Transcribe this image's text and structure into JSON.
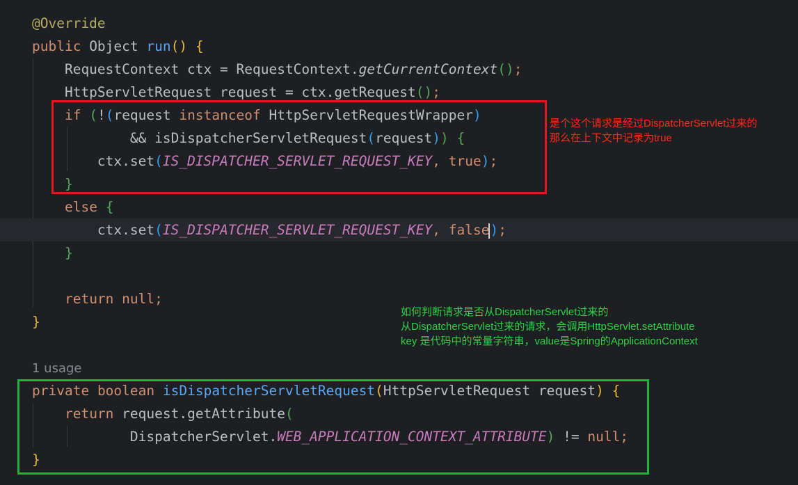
{
  "code": [
    {
      "segments": [
        {
          "t": "@Override",
          "c": "c-ann"
        }
      ]
    },
    {
      "segments": [
        {
          "t": "public",
          "c": "c-kw"
        },
        {
          "t": " Object ",
          "c": "c-txt"
        },
        {
          "t": "run",
          "c": "c-fn"
        },
        {
          "t": "()",
          "c": "c-p1"
        },
        {
          "t": " ",
          "c": "c-txt"
        },
        {
          "t": "{",
          "c": "c-p1"
        }
      ]
    },
    {
      "segments": [
        {
          "t": "    RequestContext ctx = RequestContext.",
          "c": "c-txt"
        },
        {
          "t": "getCurrentContext",
          "c": "c-ital"
        },
        {
          "t": "()",
          "c": "c-p2"
        },
        {
          "t": ";",
          "c": "c-kw"
        }
      ]
    },
    {
      "segments": [
        {
          "t": "    HttpServletRequest request = ctx.getRequest",
          "c": "c-txt"
        },
        {
          "t": "()",
          "c": "c-p2"
        },
        {
          "t": ";",
          "c": "c-kw"
        }
      ]
    },
    {
      "segments": [
        {
          "t": "    ",
          "c": "c-txt"
        },
        {
          "t": "if",
          "c": "c-kw"
        },
        {
          "t": " ",
          "c": "c-txt"
        },
        {
          "t": "(",
          "c": "c-p2"
        },
        {
          "t": "!",
          "c": "c-txt"
        },
        {
          "t": "(",
          "c": "c-p3"
        },
        {
          "t": "request ",
          "c": "c-txt"
        },
        {
          "t": "instanceof",
          "c": "c-kw"
        },
        {
          "t": " HttpServletRequestWrapper",
          "c": "c-txt"
        },
        {
          "t": ")",
          "c": "c-p3"
        }
      ]
    },
    {
      "segments": [
        {
          "t": "            && ",
          "c": "c-txt"
        },
        {
          "t": "isDispatcherServletRequest",
          "c": "c-txt"
        },
        {
          "t": "(",
          "c": "c-p3"
        },
        {
          "t": "request",
          "c": "c-txt"
        },
        {
          "t": ")",
          "c": "c-p3"
        },
        {
          "t": ")",
          "c": "c-p2"
        },
        {
          "t": " ",
          "c": "c-txt"
        },
        {
          "t": "{",
          "c": "c-p2"
        }
      ]
    },
    {
      "segments": [
        {
          "t": "        ctx.set",
          "c": "c-txt"
        },
        {
          "t": "(",
          "c": "c-p3"
        },
        {
          "t": "IS_DISPATCHER_SERVLET_REQUEST_KEY",
          "c": "c-cst"
        },
        {
          "t": ", ",
          "c": "c-kw"
        },
        {
          "t": "true",
          "c": "c-kw"
        },
        {
          "t": ")",
          "c": "c-p3"
        },
        {
          "t": ";",
          "c": "c-kw"
        }
      ]
    },
    {
      "segments": [
        {
          "t": "    ",
          "c": "c-txt"
        },
        {
          "t": "}",
          "c": "c-p2"
        }
      ]
    },
    {
      "segments": [
        {
          "t": "    ",
          "c": "c-txt"
        },
        {
          "t": "else",
          "c": "c-kw"
        },
        {
          "t": " ",
          "c": "c-txt"
        },
        {
          "t": "{",
          "c": "c-p2"
        }
      ]
    },
    {
      "current": true,
      "caretAfter": 4,
      "segments": [
        {
          "t": "        ctx.set",
          "c": "c-txt"
        },
        {
          "t": "(",
          "c": "c-p3"
        },
        {
          "t": "IS_DISPATCHER_SERVLET_REQUEST_KEY",
          "c": "c-cst"
        },
        {
          "t": ", ",
          "c": "c-kw"
        },
        {
          "t": "false",
          "c": "c-kw"
        },
        {
          "t": ")",
          "c": "c-p3"
        },
        {
          "t": ";",
          "c": "c-kw"
        }
      ]
    },
    {
      "segments": [
        {
          "t": "    ",
          "c": "c-txt"
        },
        {
          "t": "}",
          "c": "c-p2"
        }
      ]
    },
    {
      "segments": []
    },
    {
      "segments": [
        {
          "t": "    ",
          "c": "c-txt"
        },
        {
          "t": "return",
          "c": "c-kw"
        },
        {
          "t": " ",
          "c": "c-txt"
        },
        {
          "t": "null",
          "c": "c-kw"
        },
        {
          "t": ";",
          "c": "c-kw"
        }
      ]
    },
    {
      "segments": [
        {
          "t": "}",
          "c": "c-p1"
        }
      ]
    },
    {
      "segments": []
    },
    {
      "segments": [
        {
          "t": "1 usage",
          "c": "c-dim"
        }
      ]
    },
    {
      "segments": [
        {
          "t": "private",
          "c": "c-kw"
        },
        {
          "t": " ",
          "c": "c-txt"
        },
        {
          "t": "boolean",
          "c": "c-kw"
        },
        {
          "t": " ",
          "c": "c-txt"
        },
        {
          "t": "isDispatcherServletRequest",
          "c": "c-fn"
        },
        {
          "t": "(",
          "c": "c-p1"
        },
        {
          "t": "HttpServletRequest request",
          "c": "c-txt"
        },
        {
          "t": ")",
          "c": "c-p1"
        },
        {
          "t": " ",
          "c": "c-txt"
        },
        {
          "t": "{",
          "c": "c-p1"
        }
      ]
    },
    {
      "segments": [
        {
          "t": "    ",
          "c": "c-txt"
        },
        {
          "t": "return",
          "c": "c-kw"
        },
        {
          "t": " request.getAttribute",
          "c": "c-txt"
        },
        {
          "t": "(",
          "c": "c-p2"
        }
      ]
    },
    {
      "segments": [
        {
          "t": "            DispatcherServlet.",
          "c": "c-txt"
        },
        {
          "t": "WEB_APPLICATION_CONTEXT_ATTRIBUTE",
          "c": "c-cst"
        },
        {
          "t": ")",
          "c": "c-p2"
        },
        {
          "t": " != ",
          "c": "c-txt"
        },
        {
          "t": "null",
          "c": "c-kw"
        },
        {
          "t": ";",
          "c": "c-kw"
        }
      ]
    },
    {
      "segments": [
        {
          "t": "}",
          "c": "c-p1"
        }
      ]
    }
  ],
  "annotations": {
    "red_note": "是个这个请求是经过DispatcherServlet过来的\n那么在上下文中记录为true",
    "green_note": "如何判断请求是否从DispatcherServlet过来的\n从DispatcherServlet过来的请求，会调用HttpServlet.setAttribute\nkey 是代码中的常量字符串，value是Spring的ApplicationContext"
  },
  "colors": {
    "background": "#1e1f22",
    "keyword": "#cf8e6d",
    "annotation": "#b3ae60",
    "function": "#56a8f5",
    "constant": "#c77dbb",
    "text": "#bcbec4",
    "red_box": "#e4161f",
    "green_box": "#1fb43c"
  }
}
